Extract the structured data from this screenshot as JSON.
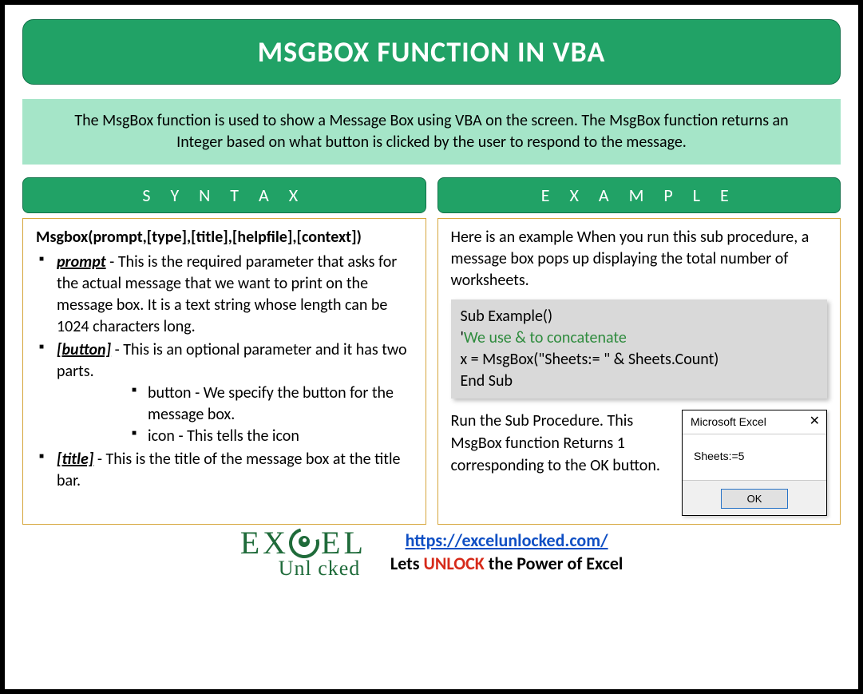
{
  "title": "MSGBOX FUNCTION IN VBA",
  "intro": "The MsgBox function is used to show a Message Box using VBA on the screen. The MsgBox function returns an Integer based on what button is clicked by the user to respond to the message.",
  "syntax": {
    "heading": "S Y N T A X",
    "signature": "Msgbox(prompt,[type],[title],[helpfile],[context])",
    "params": [
      {
        "name": "prompt",
        "suffix": " - ",
        "desc": "This is the required parameter that asks for the actual message that we want to print on the message box. It is a text string whose length can be 1024 characters long."
      },
      {
        "name": "[button]",
        "suffix": " - ",
        "desc": "This is an optional parameter and it has two parts.",
        "sub": [
          "button - We specify the button for the message box.",
          "icon - This tells the icon"
        ]
      },
      {
        "name": "[title]",
        "suffix": " - ",
        "desc": "This is the title of the message box at the title bar."
      }
    ]
  },
  "example": {
    "heading": "E X A M P L E",
    "intro": "Here is an example When you run this sub procedure, a message box pops up displaying the total number of worksheets.",
    "code": {
      "line1": "Sub Example()",
      "comment_prefix": "'",
      "comment_body": "We use & to concatenate",
      "line3": "x = MsgBox(\"Sheets:= \" & Sheets.Count)",
      "line4": "End Sub"
    },
    "runtext": "Run the Sub Procedure. This MsgBox function Returns 1 corresponding to the OK button.",
    "msgbox": {
      "title": "Microsoft Excel",
      "body": "Sheets:=5",
      "ok": "OK"
    }
  },
  "footer": {
    "logo_top_pre": "EX",
    "logo_top_post": "EL",
    "logo_bottom": "Unl   cked",
    "url": "https://excelunlocked.com/",
    "tagline_pre": "Lets ",
    "tagline_mid": "UNLOCK",
    "tagline_post": " the Power of Excel"
  }
}
